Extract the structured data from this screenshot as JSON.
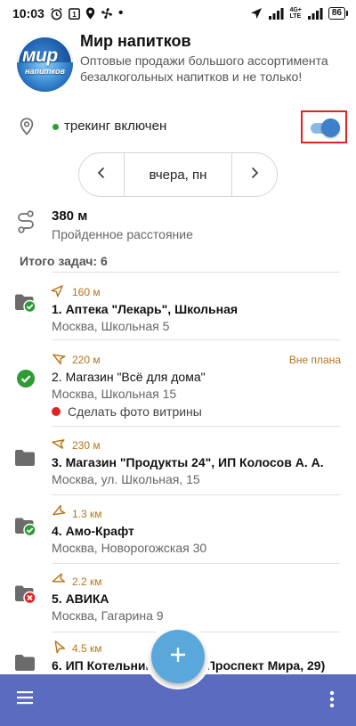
{
  "status_bar": {
    "time": "10:03",
    "network_top": "4G+",
    "network_bottom": "LTE",
    "battery": "86"
  },
  "header": {
    "logo_text_big": "мир",
    "logo_text_small": "напитков",
    "title": "Мир напитков",
    "subtitle": "Оптовые продажи большого ассортимента безалкогольных напитков и не только!"
  },
  "tracking": {
    "label": "трекинг включен",
    "enabled": true,
    "status_color": "#2e9b34"
  },
  "date_nav": {
    "label": "вчера, пн",
    "prev_icon": "chevron-left-icon",
    "next_icon": "chevron-right-icon"
  },
  "distance": {
    "value": "380 м",
    "label": "Пройденное расстояние"
  },
  "tasks_total": "Итого задач: 6",
  "tasks": [
    {
      "distance": "160 м",
      "name": "1.  Аптека \"Лекарь\", Школьная",
      "address": "Москва, Школьная 5",
      "status": "folder-done"
    },
    {
      "distance": "220 м",
      "name": "2.  Магазин \"Всё для дома\"",
      "address": "Москва, Школьная 15",
      "status": "done",
      "badge": "Вне плана",
      "subtask": "Сделать фото витрины"
    },
    {
      "distance": "230 м",
      "name": "3.  Магазин \"Продукты 24\", ИП Колосов А. А.",
      "address": "Москва, ул. Школьная, 15",
      "status": "folder"
    },
    {
      "distance": "1.3 км",
      "name": "4.  Амо-Крафт",
      "address": "Москва, Новорогожская 30",
      "status": "folder-done"
    },
    {
      "distance": "2.2 км",
      "name": "5.  АВИКА",
      "address": "Москва, Гагарина 9",
      "status": "folder-failed"
    },
    {
      "distance": "4.5 км",
      "name": "6.  ИП Котельников А. А. (Проспект Мира, 29)",
      "address": "",
      "status": "folder"
    }
  ],
  "colors": {
    "accent": "#3d7fc8",
    "bottom_bar": "#5a6bc0",
    "fab": "#5aa7dc",
    "distance_text": "#b8731a",
    "success": "#2e9b34",
    "error": "#e02424"
  },
  "bottom_bar": {
    "menu_icon": "hamburger-menu-icon",
    "add_icon": "plus-icon",
    "more_icon": "more-vertical-icon"
  }
}
